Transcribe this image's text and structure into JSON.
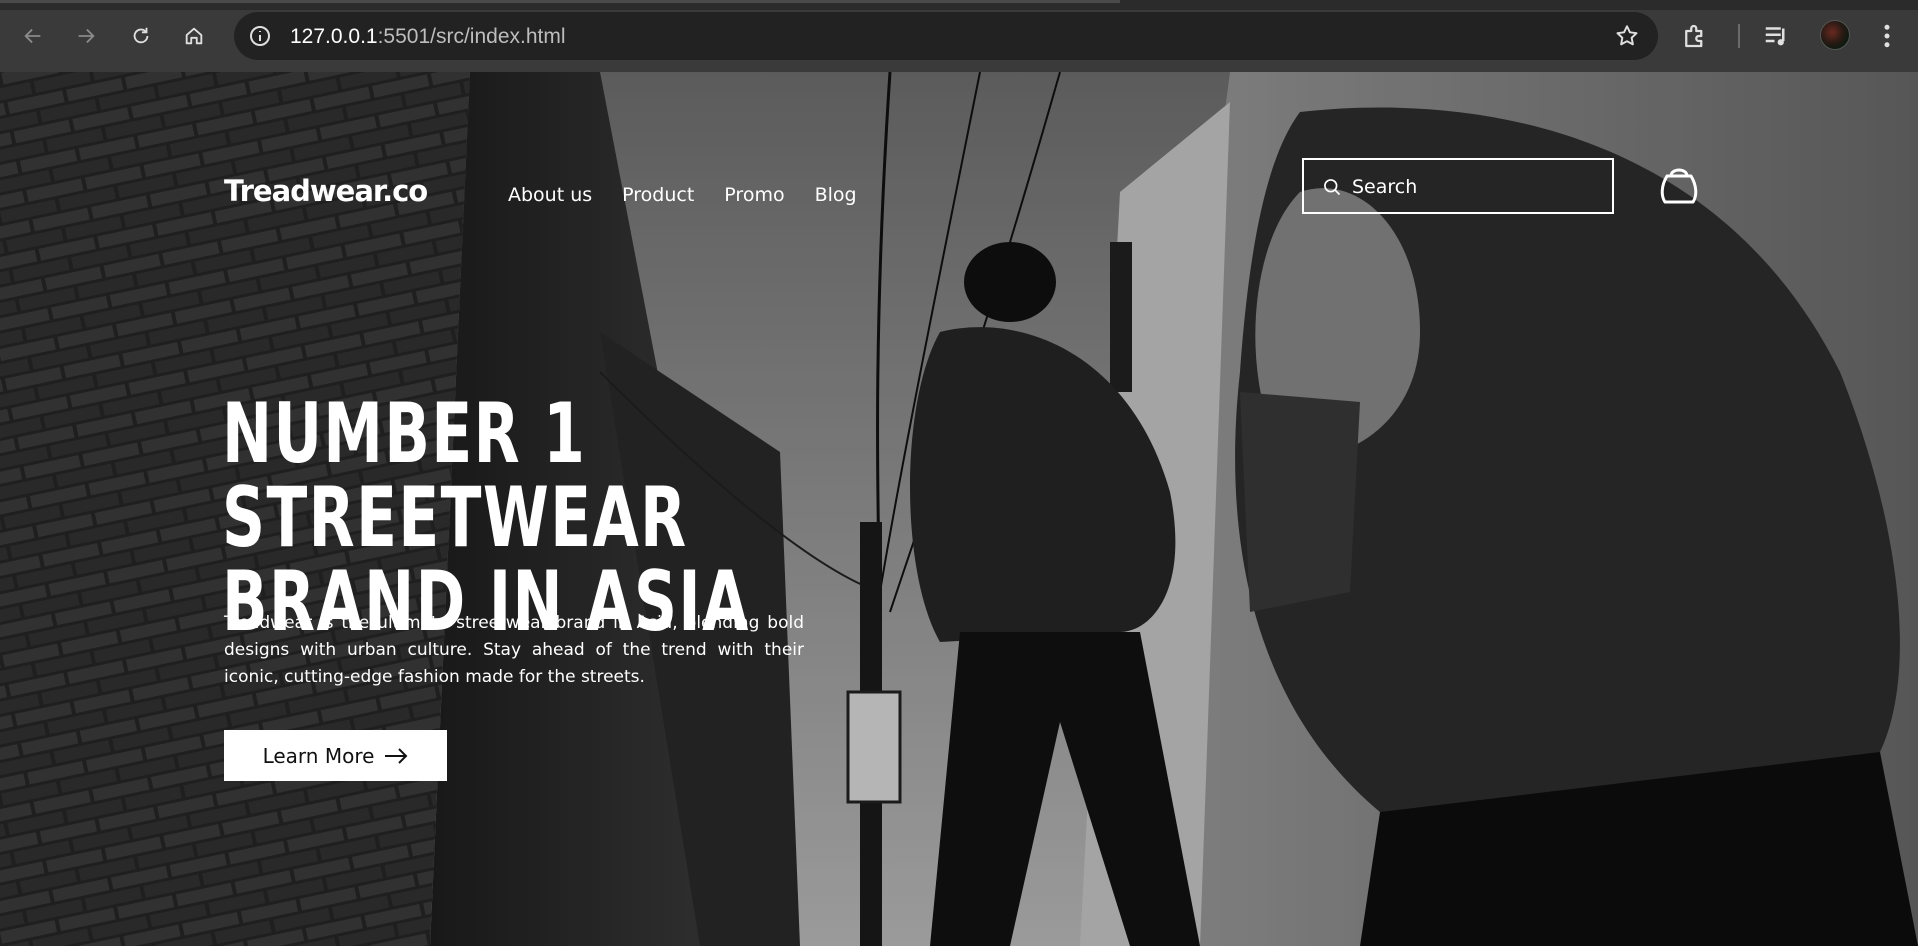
{
  "browser": {
    "url_host": "127.0.0.1",
    "url_rest": ":5501/src/index.html",
    "back_icon": "arrow-left-icon",
    "forward_icon": "arrow-right-icon",
    "reload_icon": "reload-icon",
    "home_icon": "home-icon",
    "info_icon": "info-icon",
    "bookmark_icon": "star-icon",
    "extensions_icon": "puzzle-icon",
    "media_icon": "media-queue-icon",
    "menu_icon": "kebab-menu-icon"
  },
  "site": {
    "logo": "Treadwear.co",
    "nav": [
      {
        "label": "About us"
      },
      {
        "label": "Product"
      },
      {
        "label": "Promo"
      },
      {
        "label": "Blog"
      }
    ],
    "search": {
      "placeholder": "Search",
      "icon": "search-icon"
    },
    "cart_icon": "shopping-bag-icon"
  },
  "hero": {
    "title_line1": "NUMBER 1 STREETWEAR",
    "title_line2": "BRAND IN ASIA",
    "description": "Treadwear is the ultimate streetwear brand in Asia, blending bold designs with urban culture. Stay ahead of the trend with their iconic, cutting-edge fashion made for the streets.",
    "cta_label": "Learn More",
    "cta_icon": "arrow-right-icon"
  },
  "colors": {
    "chrome_bg": "#3a3a3a",
    "omnibox_bg": "#222222",
    "text_white": "#ffffff",
    "cta_bg": "#ffffff"
  }
}
